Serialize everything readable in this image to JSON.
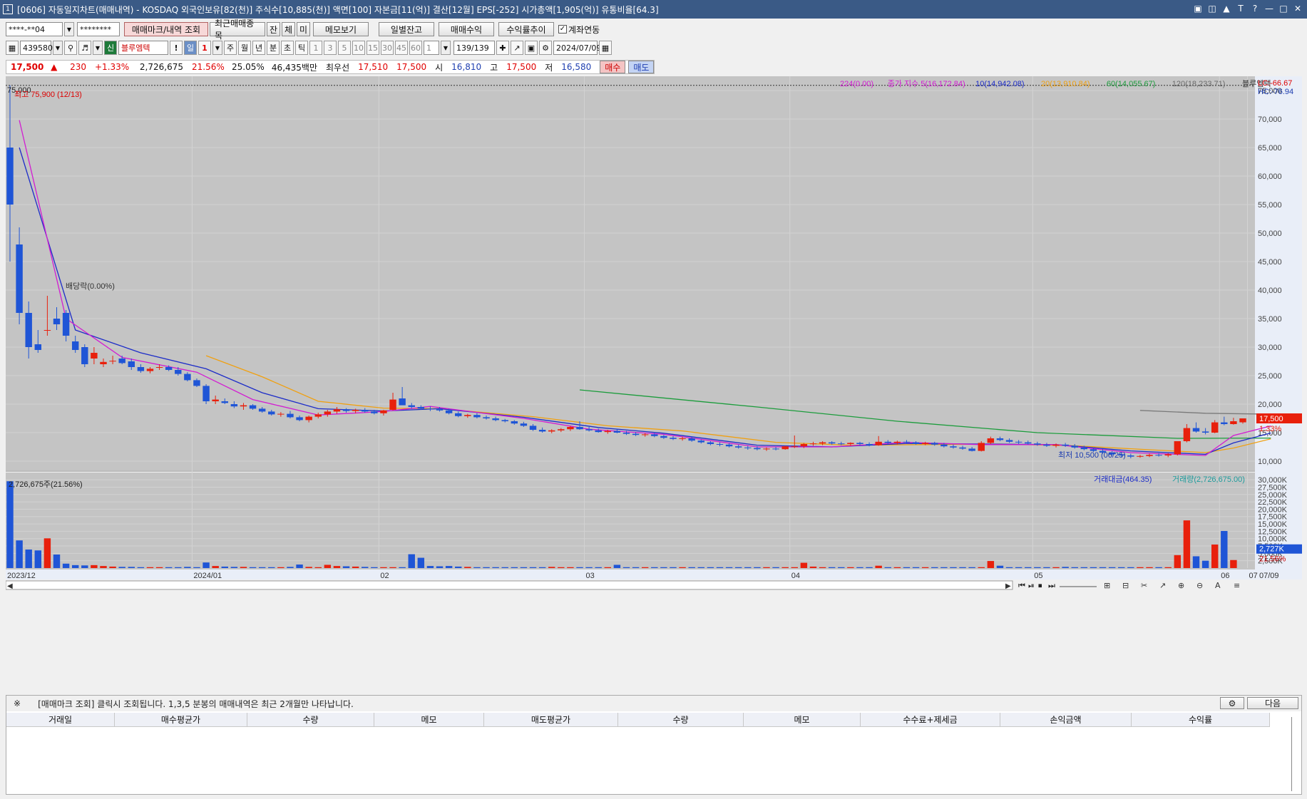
{
  "window": {
    "title": "[0606] 자동일지차트(매매내역) - KOSDAQ 외국인보유[82(천)] 주식수[10,885(천)] 액면[100] 자본금[11(억)] 결산[12월] EPS[-252] 시가총액[1,905(억)] 유통비율[64.3]",
    "icon": "1",
    "controls": [
      "restore-icon",
      "tile-icon",
      "pin-icon",
      "font-icon",
      "help-icon",
      "minimize-icon",
      "maximize-icon",
      "close-icon"
    ]
  },
  "toolbar1": {
    "account": "****-**04",
    "password": "********",
    "btn_mark": "매매마크/내역 조회",
    "btn_recent": "최근매매종목",
    "btn_jan": "잔",
    "btn_che": "체",
    "btn_mi": "미",
    "btn_memo": "메모보기",
    "btn_daily": "일별잔고",
    "btn_profit": "매매수익",
    "btn_trend": "수익률추이",
    "chk_link": "계좌연동"
  },
  "toolbar2": {
    "code": "439580",
    "badge": "신",
    "name": "블루엠텍",
    "excl": "!",
    "period_num": "1",
    "periods": [
      "일",
      "주",
      "월",
      "년",
      "분",
      "초",
      "틱"
    ],
    "intervals": [
      "1",
      "3",
      "5",
      "10",
      "15",
      "30",
      "45",
      "60"
    ],
    "interval_sel": "1",
    "count": "139",
    "count_total": "/139",
    "date": "2024/07/09"
  },
  "quote": {
    "price": "17,500",
    "arrow": "▲",
    "change": "230",
    "rate": "+1.33%",
    "volume": "2,726,675",
    "turn1": "21.56%",
    "turn2": "25.05%",
    "amount": "46,435백만",
    "best_label": "최우선",
    "ask": "17,510",
    "bid": "17,500",
    "open_label": "시",
    "open": "16,810",
    "high_label": "고",
    "high": "17,500",
    "low_label": "저",
    "low": "16,580",
    "buy": "매수",
    "sell": "매도"
  },
  "chart_data": {
    "type": "candlestick",
    "legend_price": [
      "224(0.00)",
      "종가 지수 5(16,172.84)",
      "10(14,942.08)",
      "20(13,910.84)",
      "60(14,055.67)",
      "120(18,233.71)",
      "블루엠텍"
    ],
    "legend_price_colors": [
      "#d21cd2",
      "#d21cd2",
      "#1c2cc8",
      "#f0a010",
      "#1c9c3c",
      "#6a6a6a",
      "#333333"
    ],
    "lc_label": "LC:-66.67",
    "hc_label": "HC:-76.94",
    "max_label": "최고 75,900 (12/13)",
    "min_label": "최저 10,500 (06/25)",
    "ex_div_label": "배당락(0.00%)",
    "top_left_label": "75,000",
    "y_ticks": [
      "75,000",
      "70,000",
      "65,000",
      "60,000",
      "55,000",
      "50,000",
      "45,000",
      "40,000",
      "35,000",
      "30,000",
      "25,000",
      "20,000",
      "15,000",
      "10,000"
    ],
    "y_range": [
      8500,
      77000
    ],
    "price_tag": "17,500",
    "rate_tag": "1.33%",
    "x_labels": [
      "2023/12",
      "2024/01",
      "02",
      "03",
      "04",
      "05",
      "06",
      "07",
      "07/09"
    ],
    "vol_legend": [
      "거래대금(464.35)",
      "거래량(2,726,675.00)"
    ],
    "vol_label": "2,726,675주(21.56%)",
    "vol_ticks": [
      "30,000K",
      "27,500K",
      "25,000K",
      "22,500K",
      "20,000K",
      "17,500K",
      "15,000K",
      "12,500K",
      "10,000K",
      "7,500K",
      "5,000K",
      "2,500K"
    ],
    "vol_range": [
      0,
      31000
    ],
    "vol_tag": "2,727K",
    "vol_rate_tag": "21.56%",
    "candles_ohlc": [
      [
        65000,
        75900,
        45000,
        55000
      ],
      [
        48000,
        51000,
        34000,
        36000
      ],
      [
        36000,
        38000,
        28000,
        30000
      ],
      [
        30500,
        33000,
        29000,
        29500
      ],
      [
        33000,
        39000,
        32000,
        33000
      ],
      [
        35000,
        37000,
        33000,
        34000
      ],
      [
        36000,
        36500,
        31000,
        32000
      ],
      [
        31000,
        32000,
        29000,
        29500
      ],
      [
        30000,
        30500,
        26500,
        27000
      ],
      [
        28000,
        30000,
        27000,
        29000
      ],
      [
        27000,
        28000,
        26500,
        27400
      ],
      [
        27500,
        28500,
        27000,
        27600
      ],
      [
        28000,
        28500,
        27000,
        27200
      ],
      [
        27500,
        28000,
        26000,
        26500
      ],
      [
        26500,
        27000,
        25500,
        25800
      ],
      [
        25800,
        26500,
        25400,
        26200
      ],
      [
        26500,
        27000,
        26000,
        26500
      ],
      [
        26500,
        26800,
        25800,
        26000
      ],
      [
        26000,
        26500,
        25000,
        25300
      ],
      [
        25300,
        25600,
        24000,
        24200
      ],
      [
        24200,
        24500,
        23000,
        23200
      ],
      [
        23200,
        23500,
        20000,
        20500
      ],
      [
        20500,
        21500,
        20000,
        20800
      ],
      [
        20500,
        21000,
        20000,
        20200
      ],
      [
        20000,
        20500,
        19300,
        19600
      ],
      [
        19600,
        20200,
        19000,
        19800
      ],
      [
        19800,
        20000,
        19000,
        19200
      ],
      [
        19200,
        19500,
        18500,
        18700
      ],
      [
        18700,
        19000,
        18000,
        18200
      ],
      [
        18200,
        18600,
        17800,
        18300
      ],
      [
        18300,
        18800,
        17500,
        17700
      ],
      [
        17700,
        18000,
        17000,
        17200
      ],
      [
        17200,
        18000,
        16800,
        17800
      ],
      [
        17800,
        18500,
        17500,
        18200
      ],
      [
        18200,
        19000,
        17800,
        18700
      ],
      [
        18700,
        19500,
        18300,
        19100
      ],
      [
        19100,
        19300,
        18500,
        18800
      ],
      [
        18800,
        19200,
        18400,
        19000
      ],
      [
        19000,
        19300,
        18500,
        18700
      ],
      [
        18700,
        19000,
        18200,
        18400
      ],
      [
        18400,
        19000,
        18000,
        18900
      ],
      [
        19000,
        22000,
        18900,
        20800
      ],
      [
        21000,
        23000,
        20000,
        19800
      ],
      [
        19800,
        20200,
        19200,
        19500
      ],
      [
        19500,
        19800,
        19000,
        19200
      ],
      [
        19200,
        19600,
        18800,
        19100
      ],
      [
        19100,
        19500,
        18700,
        18900
      ],
      [
        18900,
        19200,
        18200,
        18400
      ],
      [
        18400,
        18700,
        17700,
        17900
      ],
      [
        17900,
        18300,
        17600,
        18100
      ],
      [
        18100,
        18400,
        17500,
        17700
      ],
      [
        17700,
        18000,
        17300,
        17500
      ],
      [
        17500,
        17800,
        17000,
        17200
      ],
      [
        17200,
        17400,
        16800,
        17000
      ],
      [
        17000,
        17200,
        16400,
        16600
      ],
      [
        16600,
        16900,
        16000,
        16200
      ],
      [
        16200,
        16500,
        15300,
        15500
      ],
      [
        15500,
        15900,
        15000,
        15200
      ],
      [
        15200,
        15600,
        14900,
        15400
      ],
      [
        15400,
        15800,
        15100,
        15600
      ],
      [
        15600,
        16200,
        15300,
        16000
      ],
      [
        16000,
        17000,
        15500,
        15600
      ],
      [
        15600,
        16000,
        15200,
        15400
      ],
      [
        15400,
        15700,
        15000,
        15100
      ],
      [
        15100,
        15500,
        14800,
        15300
      ],
      [
        15300,
        15600,
        14900,
        15000
      ],
      [
        15000,
        15300,
        14600,
        14800
      ],
      [
        14800,
        15100,
        14400,
        14600
      ],
      [
        14600,
        14900,
        14300,
        14700
      ],
      [
        14700,
        14900,
        14200,
        14400
      ],
      [
        14400,
        14600,
        13900,
        14100
      ],
      [
        14100,
        14400,
        13700,
        13900
      ],
      [
        13900,
        14300,
        13600,
        14000
      ],
      [
        14000,
        14200,
        13400,
        13600
      ],
      [
        13600,
        13800,
        13100,
        13300
      ],
      [
        13300,
        13500,
        12800,
        13000
      ],
      [
        13000,
        13300,
        12600,
        12900
      ],
      [
        12900,
        13100,
        12400,
        12600
      ],
      [
        12600,
        12900,
        12200,
        12400
      ],
      [
        12400,
        12700,
        12000,
        12300
      ],
      [
        12300,
        12600,
        11900,
        12100
      ],
      [
        12100,
        12400,
        11800,
        12200
      ],
      [
        12200,
        12500,
        11900,
        12100
      ],
      [
        12100,
        12700,
        12000,
        12600
      ],
      [
        12600,
        14500,
        12300,
        12600
      ],
      [
        12600,
        13200,
        12300,
        13000
      ],
      [
        13000,
        13400,
        12700,
        13100
      ],
      [
        13100,
        13500,
        12800,
        13300
      ],
      [
        13300,
        13500,
        12900,
        13100
      ],
      [
        13100,
        13400,
        12800,
        13000
      ],
      [
        13000,
        13300,
        12700,
        13200
      ],
      [
        13200,
        13400,
        12800,
        13000
      ],
      [
        13000,
        13300,
        12600,
        12800
      ],
      [
        12800,
        14400,
        12700,
        13400
      ],
      [
        13400,
        13700,
        13000,
        13200
      ],
      [
        13200,
        13600,
        12900,
        13400
      ],
      [
        13400,
        13700,
        13100,
        13300
      ],
      [
        13300,
        13500,
        12900,
        13000
      ],
      [
        13000,
        13400,
        12800,
        13200
      ],
      [
        13200,
        13400,
        12700,
        12900
      ],
      [
        12900,
        13200,
        12400,
        12600
      ],
      [
        12600,
        12900,
        12200,
        12400
      ],
      [
        12400,
        12700,
        12000,
        12200
      ],
      [
        12200,
        12500,
        11700,
        11800
      ],
      [
        11800,
        13500,
        11700,
        13200
      ],
      [
        13200,
        14300,
        13000,
        14000
      ],
      [
        14000,
        14300,
        13500,
        13700
      ],
      [
        13700,
        14000,
        13200,
        13400
      ],
      [
        13400,
        13700,
        13000,
        13300
      ],
      [
        13300,
        13600,
        12900,
        13100
      ],
      [
        13100,
        13400,
        12700,
        12900
      ],
      [
        12900,
        13200,
        12500,
        12700
      ],
      [
        12700,
        13100,
        12400,
        12900
      ],
      [
        12900,
        13200,
        12500,
        12700
      ],
      [
        12700,
        13000,
        12200,
        12400
      ],
      [
        12400,
        12700,
        11900,
        12100
      ],
      [
        12100,
        12400,
        11600,
        11800
      ],
      [
        11800,
        12100,
        11300,
        11500
      ],
      [
        11500,
        11800,
        11000,
        11200
      ],
      [
        11200,
        11500,
        10700,
        11000
      ],
      [
        11000,
        11300,
        10500,
        10800
      ],
      [
        10800,
        11100,
        10600,
        10900
      ],
      [
        10900,
        11300,
        10700,
        11100
      ],
      [
        11100,
        11400,
        10800,
        11000
      ],
      [
        11000,
        11400,
        10700,
        11200
      ],
      [
        11200,
        13500,
        11000,
        13500
      ],
      [
        13500,
        16500,
        13300,
        15800
      ],
      [
        15800,
        16800,
        15000,
        15200
      ],
      [
        15200,
        15800,
        14700,
        15000
      ],
      [
        15000,
        17200,
        14900,
        16800
      ],
      [
        16800,
        17800,
        16300,
        16500
      ],
      [
        16500,
        17600,
        16400,
        17000
      ],
      [
        16810,
        17500,
        16580,
        17500
      ]
    ],
    "volumes_k": [
      29500,
      9400,
      6300,
      6000,
      10100,
      4600,
      1500,
      1000,
      900,
      1000,
      700,
      500,
      400,
      400,
      300,
      300,
      300,
      300,
      300,
      400,
      300,
      1900,
      700,
      500,
      400,
      400,
      300,
      300,
      300,
      300,
      400,
      1200,
      400,
      300,
      1100,
      700,
      600,
      500,
      400,
      300,
      300,
      300,
      300,
      4700,
      3500,
      700,
      600,
      700,
      500,
      400,
      300,
      300,
      300,
      300,
      300,
      300,
      300,
      300,
      400,
      300,
      300,
      300,
      300,
      300,
      300,
      1100,
      300,
      300,
      300,
      300,
      300,
      300,
      300,
      300,
      300,
      300,
      300,
      300,
      300,
      300,
      300,
      300,
      300,
      300,
      300,
      1800,
      500,
      300,
      300,
      300,
      300,
      300,
      300,
      800,
      300,
      300,
      300,
      300,
      300,
      300,
      300,
      300,
      300,
      300,
      300,
      2400,
      800,
      300,
      300,
      300,
      300,
      300,
      300,
      400,
      300,
      300,
      300,
      300,
      300,
      300,
      300,
      300,
      300,
      300,
      300,
      4400,
      16200,
      4000,
      2500,
      8000,
      12600,
      2727
    ],
    "ma5": [
      [
        1,
        69800
      ],
      [
        6,
        35000
      ],
      [
        12,
        28200
      ],
      [
        20,
        25600
      ],
      [
        26,
        20800
      ],
      [
        33,
        18100
      ],
      [
        40,
        18700
      ],
      [
        45,
        19600
      ],
      [
        55,
        17500
      ],
      [
        62,
        15600
      ],
      [
        70,
        14700
      ],
      [
        80,
        12500
      ],
      [
        88,
        12500
      ],
      [
        96,
        13300
      ],
      [
        104,
        12900
      ],
      [
        112,
        12900
      ],
      [
        120,
        11500
      ],
      [
        128,
        11000
      ],
      [
        131,
        14500
      ],
      [
        135,
        16172
      ]
    ],
    "ma10": [
      [
        1,
        65000
      ],
      [
        7,
        33000
      ],
      [
        14,
        29000
      ],
      [
        21,
        26200
      ],
      [
        27,
        22000
      ],
      [
        33,
        19200
      ],
      [
        40,
        18800
      ],
      [
        46,
        19200
      ],
      [
        55,
        17700
      ],
      [
        63,
        15900
      ],
      [
        70,
        14900
      ],
      [
        80,
        12800
      ],
      [
        88,
        12500
      ],
      [
        96,
        13100
      ],
      [
        104,
        13000
      ],
      [
        112,
        12900
      ],
      [
        120,
        11800
      ],
      [
        128,
        11200
      ],
      [
        131,
        13200
      ],
      [
        135,
        14942
      ]
    ],
    "ma20": [
      [
        21,
        28500
      ],
      [
        27,
        24800
      ],
      [
        33,
        20500
      ],
      [
        40,
        19300
      ],
      [
        46,
        19200
      ],
      [
        56,
        17800
      ],
      [
        64,
        16200
      ],
      [
        72,
        15300
      ],
      [
        82,
        13300
      ],
      [
        90,
        12800
      ],
      [
        98,
        12900
      ],
      [
        106,
        13000
      ],
      [
        114,
        12700
      ],
      [
        122,
        12000
      ],
      [
        128,
        11500
      ],
      [
        131,
        12300
      ],
      [
        135,
        13910
      ]
    ],
    "ma60": [
      [
        61,
        22500
      ],
      [
        80,
        19500
      ],
      [
        95,
        17000
      ],
      [
        110,
        15000
      ],
      [
        125,
        14000
      ],
      [
        135,
        14055
      ]
    ],
    "ma120": [
      [
        121,
        18900
      ],
      [
        128,
        18400
      ],
      [
        135,
        18233
      ]
    ]
  },
  "notice": {
    "mark": "※",
    "text": "[매매마크 조회] 클릭시 조회됩니다. 1,3,5 분봉의 매매내역은 최근 2개월만 나타납니다.",
    "btn_next": "다음"
  },
  "table": {
    "headers": [
      "거래일",
      "매수평균가",
      "수량",
      "메모",
      "매도평균가",
      "수량",
      "메모",
      "수수료+제세금",
      "손익금액",
      "수익률"
    ]
  }
}
